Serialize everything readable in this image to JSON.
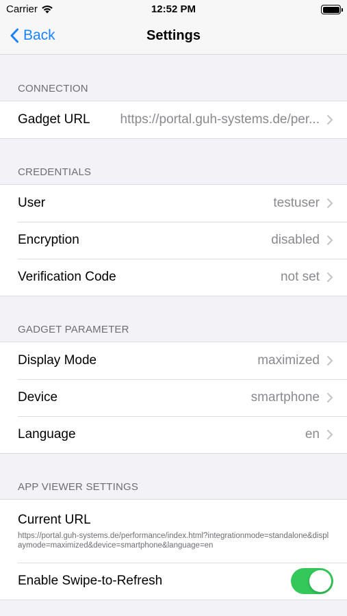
{
  "status_bar": {
    "carrier": "Carrier",
    "time": "12:52 PM"
  },
  "nav": {
    "back_label": "Back",
    "title": "Settings"
  },
  "sections": {
    "connection": {
      "header": "CONNECTION",
      "rows": [
        {
          "label": "Gadget URL",
          "value": "https://portal.guh-systems.de/per..."
        }
      ]
    },
    "credentials": {
      "header": "CREDENTIALS",
      "rows": [
        {
          "label": "User",
          "value": "testuser"
        },
        {
          "label": "Encryption",
          "value": "disabled"
        },
        {
          "label": "Verification Code",
          "value": "not set"
        }
      ]
    },
    "gadget_parameter": {
      "header": "GADGET PARAMETER",
      "rows": [
        {
          "label": "Display Mode",
          "value": "maximized"
        },
        {
          "label": "Device",
          "value": "smartphone"
        },
        {
          "label": "Language",
          "value": "en"
        }
      ]
    },
    "app_viewer": {
      "header": "APP VIEWER SETTINGS",
      "current_url_label": "Current URL",
      "current_url_value": "https://portal.guh-systems.de/performance/index.html?integrationmode=standalone&displaymode=maximized&device=smartphone&language=en",
      "swipe_label": "Enable Swipe-to-Refresh",
      "swipe_enabled": true
    }
  },
  "colors": {
    "accent": "#1a82ff",
    "toggle_on": "#34c759",
    "background": "#f2f2f7"
  }
}
